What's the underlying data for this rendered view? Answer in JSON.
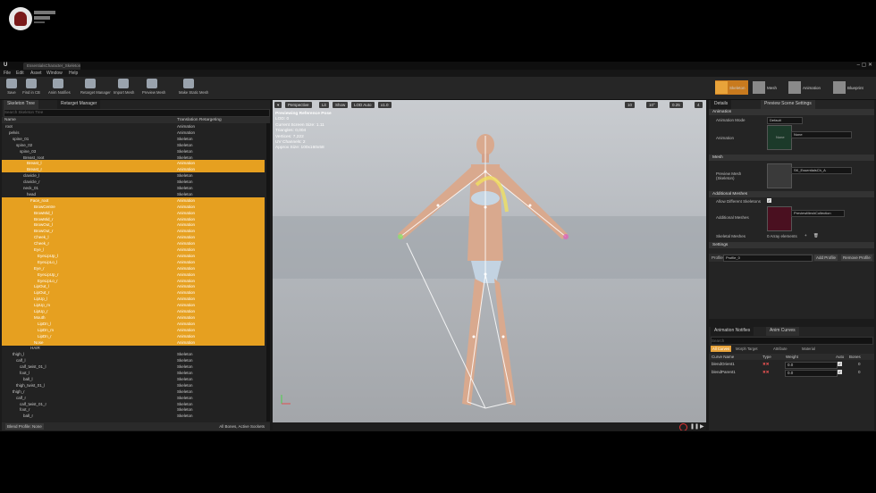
{
  "window": {
    "tab_title": "EssentialsCharacter_Skeleton",
    "menu": [
      "File",
      "Edit",
      "Asset",
      "Window",
      "Help"
    ]
  },
  "toolbar": {
    "buttons": [
      "Save",
      "Find in CB",
      "Anim Notifies",
      "Retarget Manager",
      "Import Mesh",
      "Preview Mesh",
      "Make Static Mesh"
    ],
    "modes": [
      "Skeleton",
      "Mesh",
      "Animation",
      "Blueprint"
    ]
  },
  "tree": {
    "tabs": [
      "Skeleton Tree",
      "Retarget Manager"
    ],
    "search_placeholder": "Search Skeleton Tree",
    "col_name": "Name",
    "col_retarget": "Translation Retargeting",
    "rows": [
      {
        "n": "root",
        "r": "Animation",
        "sel": false,
        "d": 0
      },
      {
        "n": "pelvis",
        "r": "Animation",
        "sel": false,
        "d": 1
      },
      {
        "n": "spine_01",
        "r": "Skeleton",
        "sel": false,
        "d": 2
      },
      {
        "n": "spine_02",
        "r": "Skeleton",
        "sel": false,
        "d": 3
      },
      {
        "n": "spine_03",
        "r": "Skeleton",
        "sel": false,
        "d": 4
      },
      {
        "n": "Breast_root",
        "r": "Skeleton",
        "sel": false,
        "d": 5
      },
      {
        "n": "Breast_l",
        "r": "Animation",
        "sel": true,
        "d": 6
      },
      {
        "n": "Breast_r",
        "r": "Animation",
        "sel": true,
        "d": 6
      },
      {
        "n": "clavicle_l",
        "r": "Skeleton",
        "sel": false,
        "d": 5
      },
      {
        "n": "clavicle_r",
        "r": "Skeleton",
        "sel": false,
        "d": 5
      },
      {
        "n": "neck_01",
        "r": "Skeleton",
        "sel": false,
        "d": 5
      },
      {
        "n": "head",
        "r": "Skeleton",
        "sel": false,
        "d": 6
      },
      {
        "n": "Face_root",
        "r": "Animation",
        "sel": true,
        "d": 7
      },
      {
        "n": "BrowCentre",
        "r": "Animation",
        "sel": true,
        "d": 8
      },
      {
        "n": "BrowMid_l",
        "r": "Animation",
        "sel": true,
        "d": 8
      },
      {
        "n": "BrowMid_r",
        "r": "Animation",
        "sel": true,
        "d": 8
      },
      {
        "n": "BrowOut_l",
        "r": "Animation",
        "sel": true,
        "d": 8
      },
      {
        "n": "BrowOut_r",
        "r": "Animation",
        "sel": true,
        "d": 8
      },
      {
        "n": "Cheek_l",
        "r": "Animation",
        "sel": true,
        "d": 8
      },
      {
        "n": "Cheek_r",
        "r": "Animation",
        "sel": true,
        "d": 8
      },
      {
        "n": "Eye_l",
        "r": "Animation",
        "sel": true,
        "d": 8
      },
      {
        "n": "EyeLipUp_l",
        "r": "Animation",
        "sel": true,
        "d": 9
      },
      {
        "n": "EyeLipLo_l",
        "r": "Animation",
        "sel": true,
        "d": 9
      },
      {
        "n": "Eye_r",
        "r": "Animation",
        "sel": true,
        "d": 8
      },
      {
        "n": "EyeLipUp_r",
        "r": "Animation",
        "sel": true,
        "d": 9
      },
      {
        "n": "EyeLipLo_r",
        "r": "Animation",
        "sel": true,
        "d": 9
      },
      {
        "n": "LipOut_l",
        "r": "Animation",
        "sel": true,
        "d": 8
      },
      {
        "n": "LipOut_r",
        "r": "Animation",
        "sel": true,
        "d": 8
      },
      {
        "n": "LipUp_l",
        "r": "Animation",
        "sel": true,
        "d": 8
      },
      {
        "n": "LipUp_m",
        "r": "Animation",
        "sel": true,
        "d": 8
      },
      {
        "n": "LipUp_r",
        "r": "Animation",
        "sel": true,
        "d": 8
      },
      {
        "n": "Mouth",
        "r": "Animation",
        "sel": true,
        "d": 8
      },
      {
        "n": "LipDn_l",
        "r": "Animation",
        "sel": true,
        "d": 9
      },
      {
        "n": "LipDn_m",
        "r": "Animation",
        "sel": true,
        "d": 9
      },
      {
        "n": "LipDn_r",
        "r": "Animation",
        "sel": true,
        "d": 9
      },
      {
        "n": "Nose",
        "r": "Animation",
        "sel": true,
        "d": 8
      },
      {
        "n": "HAIR",
        "r": "",
        "sel": false,
        "d": 7
      },
      {
        "n": "thigh_l",
        "r": "Skeleton",
        "sel": false,
        "d": 2
      },
      {
        "n": "calf_l",
        "r": "Skeleton",
        "sel": false,
        "d": 3
      },
      {
        "n": "calf_twist_01_l",
        "r": "Skeleton",
        "sel": false,
        "d": 4
      },
      {
        "n": "foot_l",
        "r": "Skeleton",
        "sel": false,
        "d": 4
      },
      {
        "n": "ball_l",
        "r": "Skeleton",
        "sel": false,
        "d": 5
      },
      {
        "n": "thigh_twist_01_l",
        "r": "Skeleton",
        "sel": false,
        "d": 3
      },
      {
        "n": "thigh_r",
        "r": "Skeleton",
        "sel": false,
        "d": 2
      },
      {
        "n": "calf_r",
        "r": "Skeleton",
        "sel": false,
        "d": 3
      },
      {
        "n": "calf_twist_01_r",
        "r": "Skeleton",
        "sel": false,
        "d": 4
      },
      {
        "n": "foot_r",
        "r": "Skeleton",
        "sel": false,
        "d": 4
      },
      {
        "n": "ball_r",
        "r": "Skeleton",
        "sel": false,
        "d": 5
      }
    ],
    "footer_left": "Blend Profile: None",
    "footer_right": "All Bones, Active Sockets"
  },
  "viewport": {
    "buttons": [
      "Perspective",
      "Lit",
      "Show",
      "LOD Auto",
      "x1.0"
    ],
    "right_values": [
      "10",
      "10°",
      "0.25",
      "4"
    ],
    "info": [
      "Previewing Reference Pose",
      "LOD: 0",
      "Current Screen Size: 1.11",
      "Triangles: 0,004",
      "Vertices: 7,222",
      "UV Channels: 2",
      "Approx Size: 100x160x58"
    ]
  },
  "details": {
    "tabs": [
      "Details",
      "Preview Scene Settings"
    ],
    "sections": {
      "animation": "Animation",
      "mesh": "Mesh",
      "additional": "Additional Meshes",
      "settings": "Settings"
    },
    "anim_mode_label": "Animation Mode",
    "anim_mode_value": "Default",
    "animation_label": "Animation",
    "animation_value": "None",
    "preview_mesh_label": "Preview Mesh (Skeleton)",
    "preview_mesh_value": "SK_EssentialsCh_A",
    "allow_diff_label": "Allow Different Skeletons",
    "additional_meshes_label": "Additional Meshes",
    "additional_meshes_value": "PreviewMeshCollection",
    "skeletal_meshes_label": "Skeletal Meshes",
    "skeletal_meshes_value": "0 Array elements",
    "profile_label": "Profile",
    "profile_value": "Profile_0",
    "add_profile": "Add Profile",
    "remove_profile": "Remove Profile"
  },
  "curves": {
    "tabs": [
      "Animation Notifies",
      "Anim Curves"
    ],
    "search_placeholder": "Search",
    "filters": [
      "All Curves",
      "Morph Target",
      "Attribute",
      "Material"
    ],
    "columns": [
      "Curve Name",
      "Type",
      "Weight",
      "Auto",
      "Bones"
    ],
    "rows": [
      {
        "name": "blendOrient1",
        "weight": "0.0",
        "bones": "0"
      },
      {
        "name": "blendParent1",
        "weight": "0.0",
        "bones": "0"
      }
    ]
  },
  "colors": {
    "selection": "#e6a020",
    "accent": "#e8a33a"
  }
}
